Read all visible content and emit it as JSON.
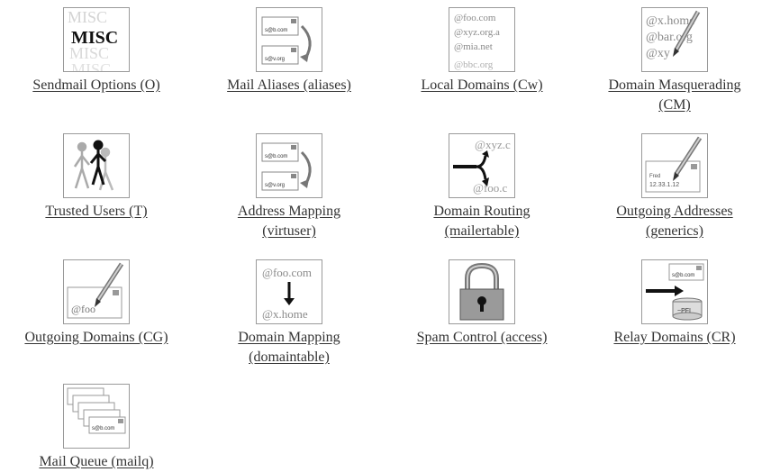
{
  "items": [
    {
      "id": "sendmail-options",
      "icon": "misc-icon",
      "line1": "Sendmail Options (O)",
      "line2": ""
    },
    {
      "id": "mail-aliases",
      "icon": "mail-aliases-icon",
      "line1": "Mail Aliases (aliases)",
      "line2": ""
    },
    {
      "id": "local-domains",
      "icon": "local-domains-icon",
      "line1": "Local Domains (Cw)",
      "line2": ""
    },
    {
      "id": "domain-masquerading",
      "icon": "domain-masquerading-icon",
      "line1": "Domain Masquerading",
      "line2": "(CM)"
    },
    {
      "id": "trusted-users",
      "icon": "trusted-users-icon",
      "line1": "Trusted Users (T)",
      "line2": ""
    },
    {
      "id": "address-mapping",
      "icon": "address-mapping-icon",
      "line1": "Address Mapping",
      "line2": "(virtuser)"
    },
    {
      "id": "domain-routing",
      "icon": "domain-routing-icon",
      "line1": "Domain Routing",
      "line2": "(mailertable)"
    },
    {
      "id": "outgoing-addresses",
      "icon": "outgoing-addresses-icon",
      "line1": "Outgoing Addresses",
      "line2": "(generics)"
    },
    {
      "id": "outgoing-domains",
      "icon": "outgoing-domains-icon",
      "line1": "Outgoing Domains (CG)",
      "line2": ""
    },
    {
      "id": "domain-mapping",
      "icon": "domain-mapping-icon",
      "line1": "Domain Mapping",
      "line2": "(domaintable)"
    },
    {
      "id": "spam-control",
      "icon": "padlock-icon",
      "line1": "Spam Control (access)",
      "line2": ""
    },
    {
      "id": "relay-domains",
      "icon": "relay-domains-icon",
      "line1": "Relay Domains (CR)",
      "line2": ""
    },
    {
      "id": "mail-queue",
      "icon": "mail-queue-icon",
      "line1": "Mail Queue (mailq)",
      "line2": ""
    }
  ],
  "icon_text": {
    "misc": "MISC",
    "local_domains": [
      "@foo.com",
      "@xyz.org.a",
      "@mia.net",
      "@bbc.org"
    ],
    "masquerade": [
      "@x.home",
      "@bar.org",
      "@xy"
    ],
    "routing": [
      "@xyz.c",
      "@foo.c"
    ],
    "generics_ip": "12.33.1.12",
    "outgoing_domain": "@foo",
    "mapping": [
      "@foo.com",
      "@x.home"
    ],
    "envelope_addr": "s@b.com",
    "envelope_addr2": "s@v.org",
    "relay_label": "~PFI"
  },
  "colors": {
    "text": "#333333",
    "frame": "#9a9a9a",
    "glyph": "#111111",
    "muted": "#9c9c9c"
  }
}
